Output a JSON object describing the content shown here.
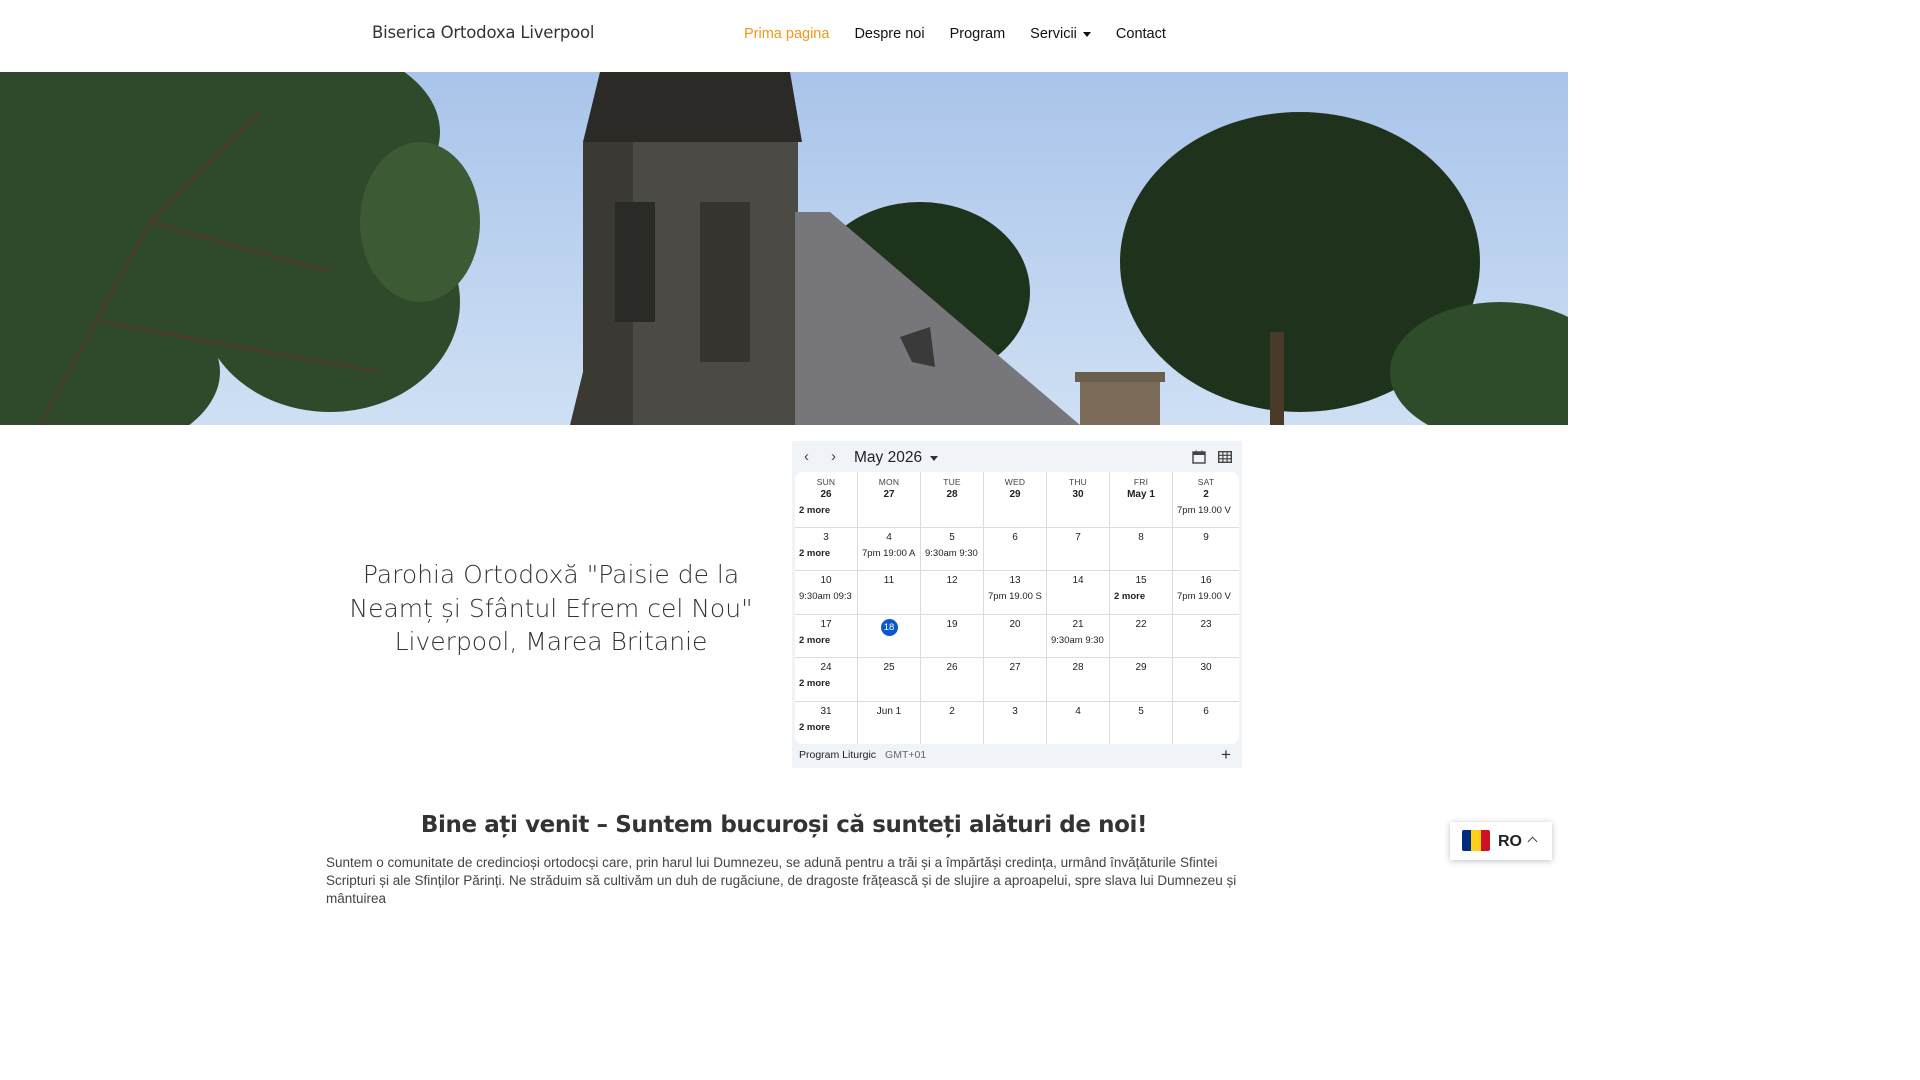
{
  "header": {
    "site_title": "Biserica Ortodoxa Liverpool",
    "nav": [
      {
        "label": "Prima pagina",
        "active": true
      },
      {
        "label": "Despre noi"
      },
      {
        "label": "Program"
      },
      {
        "label": "Servicii",
        "dropdown": true
      },
      {
        "label": "Contact"
      }
    ]
  },
  "hero": {
    "image": "church-photo"
  },
  "parish": {
    "line1": "Parohia Ortodoxă \"Paisie de la",
    "line2": "Neamț și Sfântul Efrem cel Nou\"",
    "line3": "Liverpool, Marea Britanie"
  },
  "calendar": {
    "prev_label": "‹",
    "next_label": "›",
    "month": "May 2026",
    "days_of_week": [
      "SUN",
      "MON",
      "TUE",
      "WED",
      "THU",
      "FRI",
      "SAT"
    ],
    "weeks": [
      [
        {
          "d": "26",
          "ev": "2 more",
          "more": true
        },
        {
          "d": "27"
        },
        {
          "d": "28"
        },
        {
          "d": "29"
        },
        {
          "d": "30"
        },
        {
          "d": "May 1"
        },
        {
          "d": "2",
          "ev": "7pm 19.00 V"
        }
      ],
      [
        {
          "d": "3",
          "ev": "2 more",
          "more": true
        },
        {
          "d": "4",
          "ev": "7pm 19:00 A"
        },
        {
          "d": "5",
          "ev": "9:30am 9:30"
        },
        {
          "d": "6"
        },
        {
          "d": "7"
        },
        {
          "d": "8"
        },
        {
          "d": "9"
        }
      ],
      [
        {
          "d": "10",
          "ev": "9:30am 09:3"
        },
        {
          "d": "11"
        },
        {
          "d": "12"
        },
        {
          "d": "13",
          "ev": "7pm 19.00 S"
        },
        {
          "d": "14"
        },
        {
          "d": "15",
          "ev": "2 more",
          "more": true
        },
        {
          "d": "16",
          "ev": "7pm 19.00 V"
        }
      ],
      [
        {
          "d": "17",
          "ev": "2 more",
          "more": true
        },
        {
          "d": "18",
          "today": true
        },
        {
          "d": "19"
        },
        {
          "d": "20"
        },
        {
          "d": "21",
          "ev": "9:30am 9:30"
        },
        {
          "d": "22"
        },
        {
          "d": "23"
        }
      ],
      [
        {
          "d": "24",
          "ev": "2 more",
          "more": true
        },
        {
          "d": "25"
        },
        {
          "d": "26"
        },
        {
          "d": "27"
        },
        {
          "d": "28"
        },
        {
          "d": "29"
        },
        {
          "d": "30"
        }
      ],
      [
        {
          "d": "31",
          "ev": "2 more",
          "more": true
        },
        {
          "d": "Jun 1"
        },
        {
          "d": "2"
        },
        {
          "d": "3"
        },
        {
          "d": "4"
        },
        {
          "d": "5"
        },
        {
          "d": "6"
        }
      ]
    ],
    "calendar_name": "Program Liturgic",
    "timezone": "GMT+01",
    "add_label": "+"
  },
  "welcome": {
    "title": "Bine ați venit – Suntem bucuroși că sunteți alături de noi!",
    "text": "Suntem o comunitate de credincioși ortodocși care, prin harul lui Dumnezeu, se adună pentru a trăi și a împărtăși credința, urmând învățăturile Sfintei Scripturi și ale Sfinților Părinți. Ne străduim să cultivăm un duh de rugăciune, de dragoste frățească și de slujire a aproapelui, spre slava lui Dumnezeu și mântuirea"
  },
  "language": {
    "code": "RO",
    "flag_colors": [
      "#002b7f",
      "#fcd116",
      "#ce1126"
    ]
  }
}
